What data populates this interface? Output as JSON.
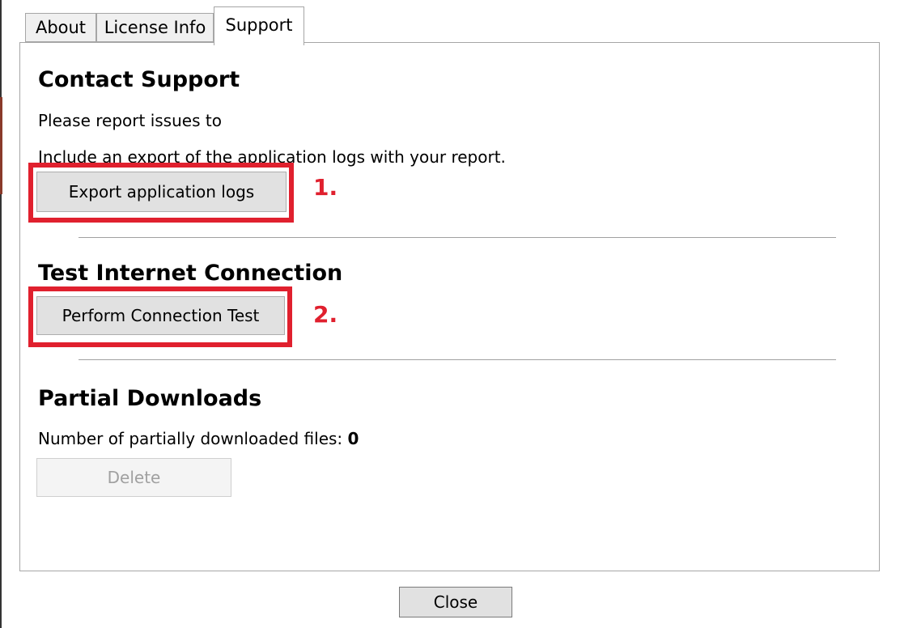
{
  "tabs": [
    {
      "label": "About"
    },
    {
      "label": "License Info"
    },
    {
      "label": "Support",
      "selected": true
    }
  ],
  "contact_support": {
    "heading": "Contact Support",
    "report_text": "Please report issues to",
    "include_text": "Include an export of the application logs with your report.",
    "export_button_label": "Export application logs",
    "annotation": "1."
  },
  "connection_test": {
    "heading": "Test Internet Connection",
    "button_label": "Perform Connection Test",
    "annotation": "2."
  },
  "partial_downloads": {
    "heading": "Partial Downloads",
    "count_label": "Number of partially downloaded files:",
    "count_value": "0",
    "delete_button_label": "Delete",
    "delete_enabled": false
  },
  "footer": {
    "close_button_label": "Close"
  },
  "colors": {
    "annotation_red": "#e0202e",
    "button_face": "#e1e1e1",
    "tab_inactive": "#f0f0f0",
    "border": "#a6a6a6"
  }
}
